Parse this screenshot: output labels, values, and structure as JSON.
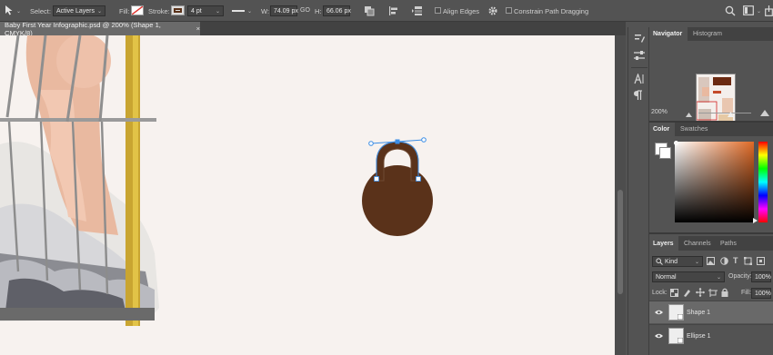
{
  "options_bar": {
    "select_label": "Select:",
    "select_value": "Active Layers",
    "fill_label": "Fill:",
    "stroke_label": "Stroke:",
    "stroke_width": "4 pt",
    "w_label": "W:",
    "w_value": "74.09 px",
    "link_icon": "GO",
    "h_label": "H:",
    "h_value": "66.06 px",
    "align_edges": "Align Edges",
    "constrain": "Constrain Path Dragging"
  },
  "document": {
    "tab_title": "Baby First Year Infographic.psd @ 200% (Shape 1, CMYK/8)",
    "close": "×"
  },
  "navigator": {
    "tabs": [
      "Navigator",
      "Histogram"
    ],
    "zoom": "200%"
  },
  "color": {
    "tabs": [
      "Color",
      "Swatches"
    ],
    "accent": "#e06a26"
  },
  "layers": {
    "tabs": [
      "Layers",
      "Channels",
      "Paths"
    ],
    "kind_label": "Kind",
    "blend_mode": "Normal",
    "opacity_label": "Opacity:",
    "opacity_value": "100%",
    "lock_label": "Lock:",
    "fill_label": "Fill:",
    "fill_value": "100%",
    "items": [
      {
        "name": "Shape 1"
      },
      {
        "name": "Ellipse 1"
      }
    ]
  },
  "artwork": {
    "shape_color": "#5a321a",
    "canvas_color": "#f7f2ef"
  }
}
